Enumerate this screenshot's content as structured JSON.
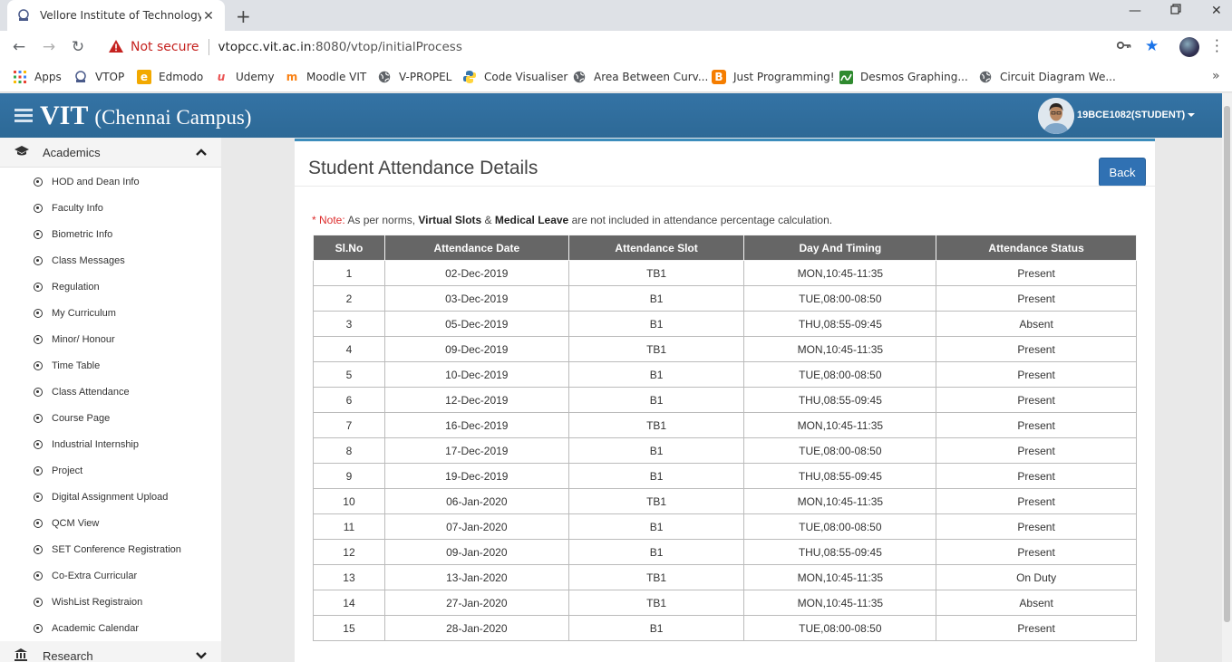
{
  "browser": {
    "tab_title": "Vellore Institute of Technology (V",
    "not_secure_label": "Not secure",
    "url_host": "vtopcc.vit.ac.in",
    "url_rest": ":8080/vtop/initialProcess",
    "bookmarks": [
      {
        "label": "Apps",
        "icon": "apps-grid-icon"
      },
      {
        "label": "VTOP",
        "icon": "vit-logo-icon"
      },
      {
        "label": "Edmodo",
        "icon": "edmodo-icon"
      },
      {
        "label": "Udemy",
        "icon": "udemy-icon"
      },
      {
        "label": "Moodle VIT",
        "icon": "moodle-icon"
      },
      {
        "label": "V-PROPEL",
        "icon": "globe-icon"
      },
      {
        "label": "Code Visualiser",
        "icon": "python-icon"
      },
      {
        "label": "Area Between Curv...",
        "icon": "globe-icon"
      },
      {
        "label": "Just Programming!",
        "icon": "blogger-icon"
      },
      {
        "label": "Desmos Graphing...",
        "icon": "desmos-icon"
      },
      {
        "label": "Circuit Diagram We...",
        "icon": "globe-icon"
      }
    ]
  },
  "header": {
    "brand_main": "VIT",
    "brand_sub": "(Chennai Campus)",
    "user": "19BCE1082(STUDENT)"
  },
  "sidebar": {
    "section_academics": "Academics",
    "section_research": "Research",
    "items": [
      "HOD and Dean Info",
      "Faculty Info",
      "Biometric Info",
      "Class Messages",
      "Regulation",
      "My Curriculum",
      "Minor/ Honour",
      "Time Table",
      "Class Attendance",
      "Course Page",
      "Industrial Internship",
      "Project",
      "Digital Assignment Upload",
      "QCM View",
      "SET Conference Registration",
      "Co-Extra Curricular",
      "WishList Registraion",
      "Academic Calendar"
    ]
  },
  "main": {
    "title": "Student Attendance Details",
    "back_label": "Back",
    "note_marker": "* Note:",
    "note_part1": " As per norms, ",
    "note_bold1": "Virtual Slots",
    "note_part2": " & ",
    "note_bold2": "Medical Leave",
    "note_part3": " are not included in attendance percentage calculation.",
    "columns": [
      "Sl.No",
      "Attendance Date",
      "Attendance Slot",
      "Day And Timing",
      "Attendance Status"
    ],
    "rows": [
      [
        "1",
        "02-Dec-2019",
        "TB1",
        "MON,10:45-11:35",
        "Present"
      ],
      [
        "2",
        "03-Dec-2019",
        "B1",
        "TUE,08:00-08:50",
        "Present"
      ],
      [
        "3",
        "05-Dec-2019",
        "B1",
        "THU,08:55-09:45",
        "Absent"
      ],
      [
        "4",
        "09-Dec-2019",
        "TB1",
        "MON,10:45-11:35",
        "Present"
      ],
      [
        "5",
        "10-Dec-2019",
        "B1",
        "TUE,08:00-08:50",
        "Present"
      ],
      [
        "6",
        "12-Dec-2019",
        "B1",
        "THU,08:55-09:45",
        "Present"
      ],
      [
        "7",
        "16-Dec-2019",
        "TB1",
        "MON,10:45-11:35",
        "Present"
      ],
      [
        "8",
        "17-Dec-2019",
        "B1",
        "TUE,08:00-08:50",
        "Present"
      ],
      [
        "9",
        "19-Dec-2019",
        "B1",
        "THU,08:55-09:45",
        "Present"
      ],
      [
        "10",
        "06-Jan-2020",
        "TB1",
        "MON,10:45-11:35",
        "Present"
      ],
      [
        "11",
        "07-Jan-2020",
        "B1",
        "TUE,08:00-08:50",
        "Present"
      ],
      [
        "12",
        "09-Jan-2020",
        "B1",
        "THU,08:55-09:45",
        "Present"
      ],
      [
        "13",
        "13-Jan-2020",
        "TB1",
        "MON,10:45-11:35",
        "On Duty"
      ],
      [
        "14",
        "27-Jan-2020",
        "TB1",
        "MON,10:45-11:35",
        "Absent"
      ],
      [
        "15",
        "28-Jan-2020",
        "B1",
        "TUE,08:00-08:50",
        "Present"
      ]
    ]
  },
  "colors": {
    "header_blue": "#2d6996",
    "absent_red": "#e31e1e",
    "note_red": "#dd2b2b",
    "button_blue": "#3071b3",
    "table_header_gray": "#666666"
  }
}
